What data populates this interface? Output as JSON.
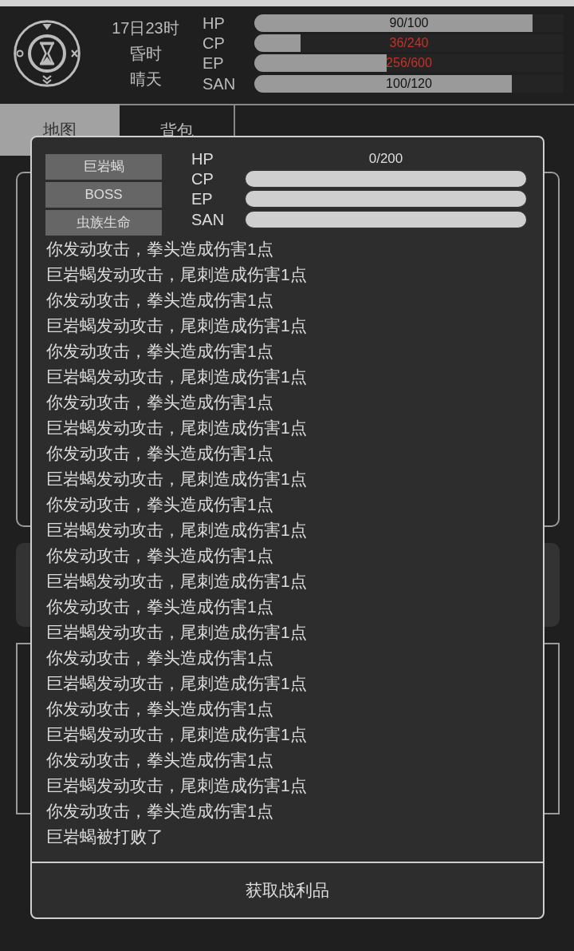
{
  "header": {
    "time": "17日23时",
    "period": "昏时",
    "weather": "晴天",
    "stats": [
      {
        "label": "HP",
        "reading": "90/100",
        "level": 0.9,
        "alert": false
      },
      {
        "label": "CP",
        "reading": "36/240",
        "level": 0.15,
        "alert": true
      },
      {
        "label": "EP",
        "reading": "256/600",
        "level": 0.427,
        "alert": true
      },
      {
        "label": "SAN",
        "reading": "100/120",
        "level": 0.833,
        "alert": false
      }
    ]
  },
  "tabs": [
    {
      "label": "地图",
      "selected": true
    },
    {
      "label": "背包",
      "selected": false
    }
  ],
  "dialog": {
    "enemy": {
      "name": "巨岩蝎",
      "rank": "BOSS",
      "species": "虫族生命"
    },
    "stats": [
      {
        "label": "HP",
        "reading": "0/200"
      },
      {
        "label": "CP",
        "level": 1
      },
      {
        "label": "EP",
        "level": 1
      },
      {
        "label": "SAN",
        "level": 1
      }
    ],
    "log": [
      "你发动攻击，拳头造成伤害1点",
      "巨岩蝎发动攻击，尾刺造成伤害1点",
      "你发动攻击，拳头造成伤害1点",
      "巨岩蝎发动攻击，尾刺造成伤害1点",
      "你发动攻击，拳头造成伤害1点",
      "巨岩蝎发动攻击，尾刺造成伤害1点",
      "你发动攻击，拳头造成伤害1点",
      "巨岩蝎发动攻击，尾刺造成伤害1点",
      "你发动攻击，拳头造成伤害1点",
      "巨岩蝎发动攻击，尾刺造成伤害1点",
      "你发动攻击，拳头造成伤害1点",
      "巨岩蝎发动攻击，尾刺造成伤害1点",
      "你发动攻击，拳头造成伤害1点",
      "巨岩蝎发动攻击，尾刺造成伤害1点",
      "你发动攻击，拳头造成伤害1点",
      "巨岩蝎发动攻击，尾刺造成伤害1点",
      "你发动攻击，拳头造成伤害1点",
      "巨岩蝎发动攻击，尾刺造成伤害1点",
      "你发动攻击，拳头造成伤害1点",
      "巨岩蝎发动攻击，尾刺造成伤害1点",
      "你发动攻击，拳头造成伤害1点",
      "巨岩蝎发动攻击，尾刺造成伤害1点",
      "你发动攻击，拳头造成伤害1点",
      "巨岩蝎被打败了"
    ],
    "button": "获取战利品"
  }
}
